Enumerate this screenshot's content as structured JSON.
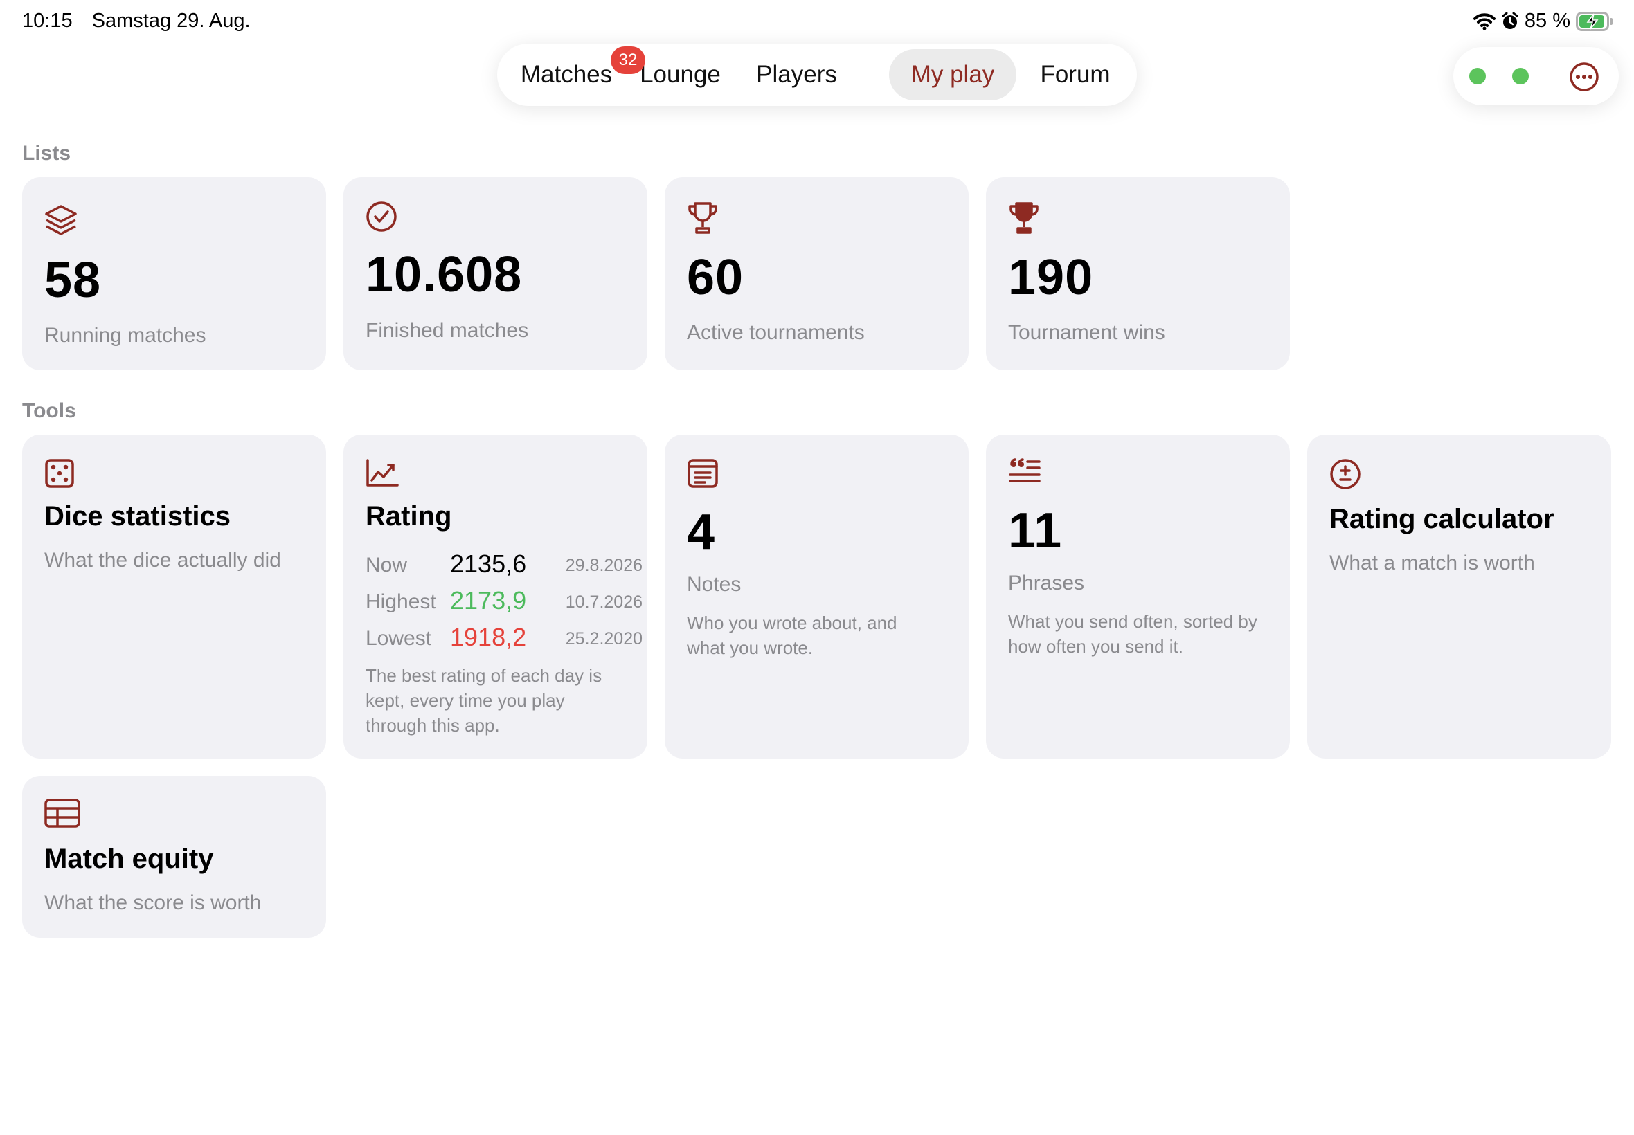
{
  "status_bar": {
    "time": "10:15",
    "date": "Samstag 29. Aug.",
    "battery": "85 %",
    "icons": [
      "wifi-icon",
      "alarm-icon",
      "battery-charging-icon"
    ]
  },
  "tabs": [
    {
      "label": "Matches",
      "badge": "32"
    },
    {
      "label": "Lounge"
    },
    {
      "label": "Players"
    },
    {
      "label": "My play",
      "active": true
    },
    {
      "label": "Forum"
    }
  ],
  "top_right": {
    "indicators": [
      "green-dot",
      "green-dot"
    ],
    "menu_icon": "more-icon"
  },
  "lists": {
    "section_label": "Lists",
    "cards": [
      {
        "icon": "stack-icon",
        "value": "58",
        "label": "Running matches"
      },
      {
        "icon": "checkmark-circle-icon",
        "value": "10.608",
        "label": "Finished matches"
      },
      {
        "icon": "trophy-outline-icon",
        "value": "60",
        "label": "Active tournaments"
      },
      {
        "icon": "trophy-filled-icon",
        "value": "190",
        "label": "Tournament wins"
      }
    ]
  },
  "tools": {
    "section_label": "Tools",
    "dice": {
      "icon": "dice-icon",
      "title": "Dice statistics",
      "subtitle": "What the dice actually did"
    },
    "rating": {
      "icon": "chart-icon",
      "title": "Rating",
      "rows": [
        {
          "label": "Now",
          "value": "2135,6",
          "date": "29.8.2026"
        },
        {
          "label": "Highest",
          "value": "2173,9",
          "date": "10.7.2026"
        },
        {
          "label": "Lowest",
          "value": "1918,2",
          "date": "25.2.2020"
        }
      ],
      "note": "The best rating of each day is kept, every time you play through this app."
    },
    "notes": {
      "icon": "notes-icon",
      "value": "4",
      "label": "Notes",
      "desc": "Who you wrote about, and what you wrote."
    },
    "phrases": {
      "icon": "quote-icon",
      "value": "11",
      "label": "Phrases",
      "desc": "What you send often, sorted by how often you send it."
    },
    "calculator": {
      "icon": "plus-minus-icon",
      "title": "Rating calculator",
      "subtitle": "What a match is worth"
    },
    "equity": {
      "icon": "table-icon",
      "title": "Match equity",
      "subtitle": "What the score is worth"
    }
  },
  "colors": {
    "accent": "#8e2a22",
    "positive": "#4cba5c",
    "negative": "#e5423a",
    "card_bg": "#f1f1f5",
    "muted_text": "#8a8a8e",
    "indicator": "#5cc45c"
  }
}
